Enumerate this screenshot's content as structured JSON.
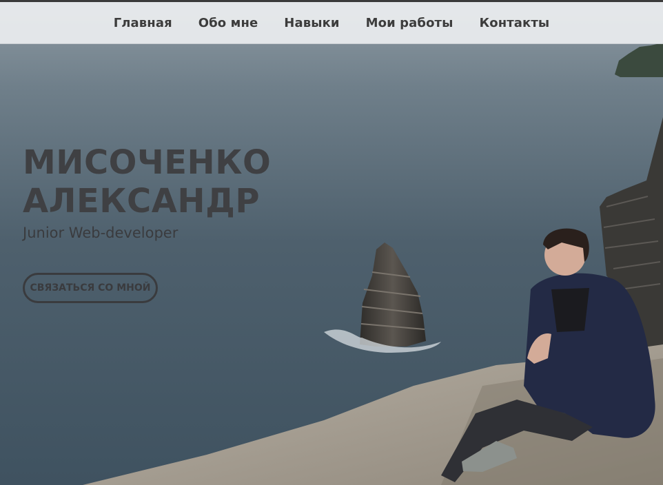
{
  "nav": {
    "items": [
      {
        "label": "Главная"
      },
      {
        "label": "Обо мне"
      },
      {
        "label": "Навыки"
      },
      {
        "label": "Мои работы"
      },
      {
        "label": "Контакты"
      }
    ]
  },
  "hero": {
    "name_line1": "МИСОЧЕНКО",
    "name_line2": "АЛЕКСАНДР",
    "role": "Junior Web-developer",
    "cta_label": "СВЯЗАТЬСЯ СО МНОЙ"
  },
  "colors": {
    "text": "#3f4043",
    "topbar": "#ebeef0",
    "sea": "#4f6270"
  }
}
